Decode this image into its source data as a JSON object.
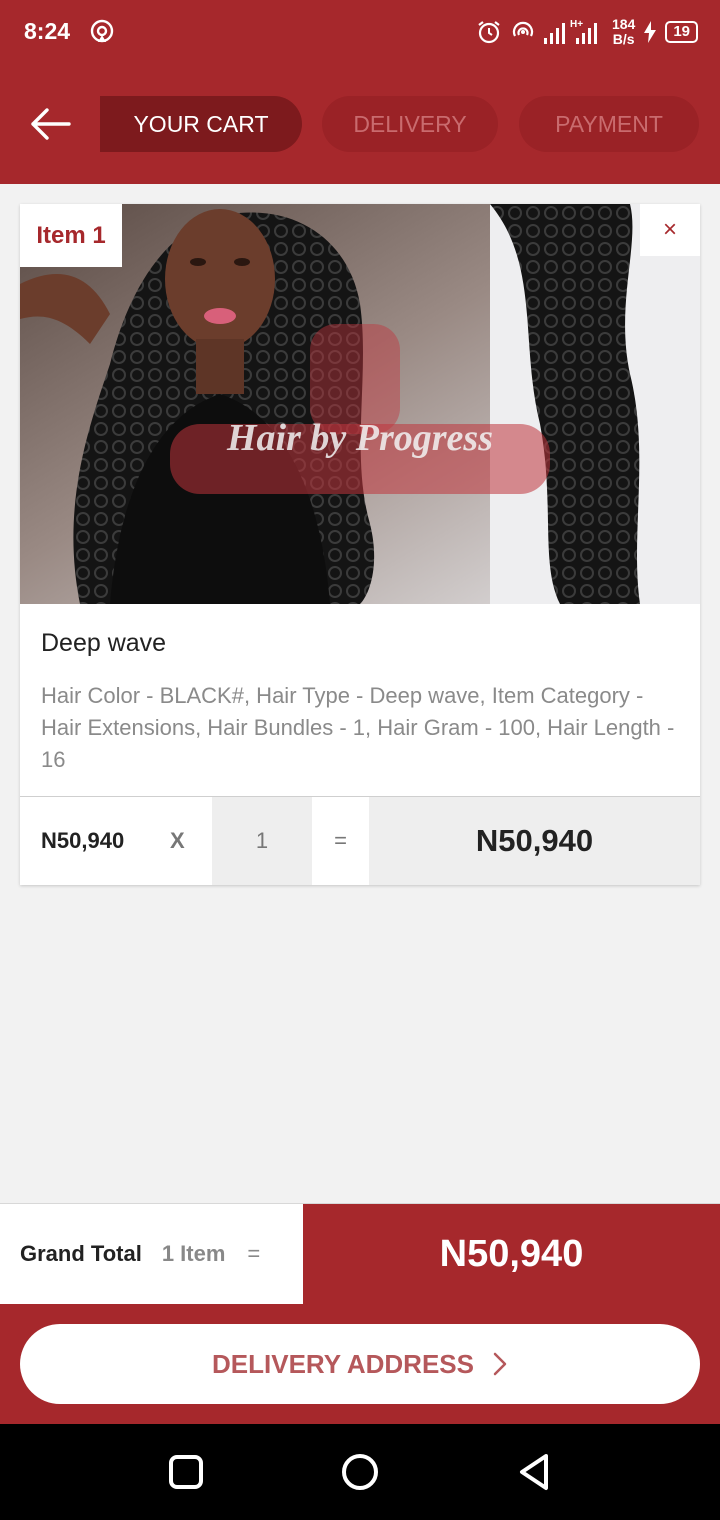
{
  "status_bar": {
    "time": "8:24",
    "speed_value": "184",
    "speed_unit": "B/s",
    "battery": "19"
  },
  "header": {
    "steps": [
      {
        "label": "YOUR CART",
        "active": true
      },
      {
        "label": "DELIVERY",
        "active": false
      },
      {
        "label": "PAYMENT",
        "active": false
      }
    ]
  },
  "cart": {
    "items": [
      {
        "tag": "Item 1",
        "remove_icon": "×",
        "watermark": "Hair by Progress",
        "name": "Deep wave",
        "description": "Hair Color - BLACK#, Hair Type - Deep wave, Item Category - Hair Extensions, Hair Bundles - 1, Hair Gram - 100, Hair Length - 16",
        "unit_price": "N50,940",
        "times": "X",
        "quantity": "1",
        "equals": "=",
        "line_total": "N50,940"
      }
    ]
  },
  "summary": {
    "label": "Grand Total",
    "count": "1 Item",
    "equals": "=",
    "total": "N50,940"
  },
  "footer": {
    "button_label": "DELIVERY ADDRESS"
  },
  "colors": {
    "brand": "#a6282c",
    "brand_dark": "#7d1a1d"
  }
}
